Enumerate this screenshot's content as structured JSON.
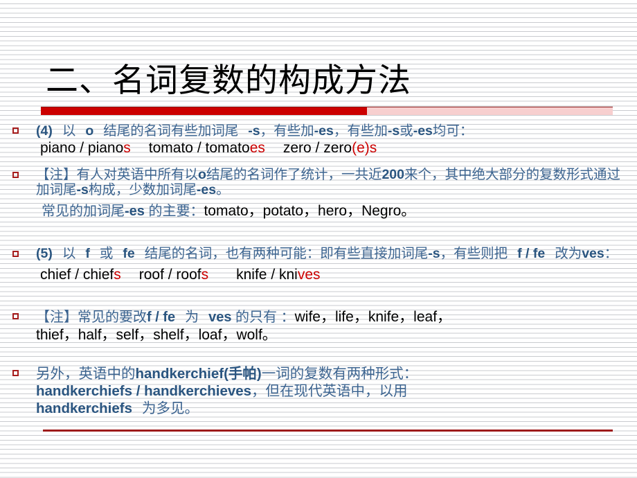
{
  "slide": {
    "title": "二、名词复数的构成方法",
    "theme": {
      "title_color": "#000000",
      "accent_red": "#cc0000",
      "rule_red": "#9e1b1b",
      "body_blue": "#3c6490",
      "bold_blue": "#2a5580",
      "example_black": "#000000",
      "suffix_red": "#cc0000",
      "background": "#ffffff",
      "stripe": "#c9cbcf"
    },
    "bullet_marker": "hollow-red-square"
  },
  "blocks": {
    "b1": {
      "line1": {
        "t1": "(4)",
        "t2": "以",
        "t3": "o",
        "t4": "结尾的名词有些加词尾",
        "t5": "-s",
        "t6": "，有些加",
        "t7": "-es",
        "t8": "，有些加",
        "t9": "-s",
        "t10": "或",
        "t11": "-es",
        "t12": "均可："
      },
      "line2": {
        "e1": "piano / piano",
        "e1s": "s",
        "e2": "tomato / tomato",
        "e2s": "es",
        "e3": "zero / zero",
        "e3s": "(e)s"
      }
    },
    "b2": {
      "line1": {
        "t1": "【注】有人对英语中所有以",
        "t2": "o",
        "t3": "结尾的名词作了统计，一共近",
        "t4": "200",
        "t5": "来个，其中绝大部分的复数形式通过加词尾",
        "t6": "-s",
        "t7": "构成，少数加词尾",
        "t8": "-es",
        "t9": "。"
      },
      "line2": {
        "t1": "常见的加词尾",
        "t2": "-es",
        "t3": " 的主要：",
        "t4": "tomato，potato，hero，Negro。"
      }
    },
    "b3": {
      "line1": {
        "t1": "(5)",
        "t2": "以",
        "t3": "f",
        "t4": "或",
        "t5": "fe",
        "t6": "结尾的名词，也有两种可能：即有些直接加词尾",
        "t7": "-s",
        "t8": "，有些则把",
        "t9": "f / fe",
        "t10": "改为",
        "t11": "ves",
        "t12": "："
      },
      "line2": {
        "e1": "chief / chief",
        "e1s": "s",
        "e2": "roof / roof",
        "e2s": "s",
        "e3": "knife / kni",
        "e3s": "ves"
      }
    },
    "b4": {
      "line1": {
        "t1": "【注】常见的要改",
        "t2": "f / fe",
        "t3": "为",
        "t4": "ves",
        "t5": " 的只有 ：",
        "t6": "wife，life，knife，leaf，"
      },
      "line2": {
        "t1": "thief，half，self，shelf，loaf，wolf。"
      }
    },
    "b5": {
      "line1": {
        "t1": "另外，英语中的",
        "t2": "handkerchief(手帕)",
        "t3": "一词的复数有两种形式："
      },
      "line2": {
        "t1": "handkerchiefs / handkerchieves",
        "t2": "，但在现代英语中，以用"
      },
      "line3": {
        "t1": "handkerchiefs",
        "t2": "为多见。"
      }
    }
  }
}
